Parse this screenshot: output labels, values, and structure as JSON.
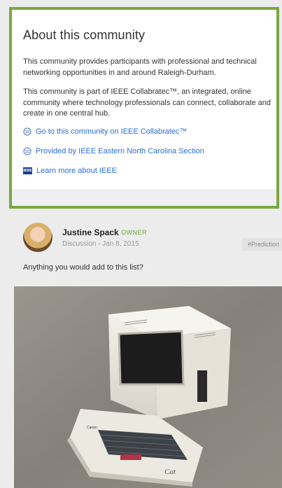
{
  "about": {
    "title": "About this community",
    "paragraph1": "This community provides participants with professional and technical networking opportunities in and around Raleigh-Durham.",
    "paragraph2": "This community is part of IEEE Collabratec™, an integrated, online community where technology professionals can connect, collaborate and create in one central hub.",
    "links": [
      {
        "label": "Go to this community on IEEE Collabratec™",
        "icon": "globe-icon"
      },
      {
        "label": "Provided by IEEE Eastern North Carolina Section",
        "icon": "globe-icon"
      },
      {
        "label": "Learn more about IEEE",
        "icon": "ieee-logo-icon"
      }
    ],
    "ieee_badge": "IEEE",
    "accent_color": "#7aa83f",
    "link_color": "#2a6fd6"
  },
  "post": {
    "author": "Justine Spack",
    "role": "OWNER",
    "meta": "Discussion  -  Jan 8, 2015",
    "tag": "#Prediction",
    "text": "Anything you would add to this list?",
    "image": {
      "brand": "Canon",
      "signature": "Cat"
    }
  }
}
